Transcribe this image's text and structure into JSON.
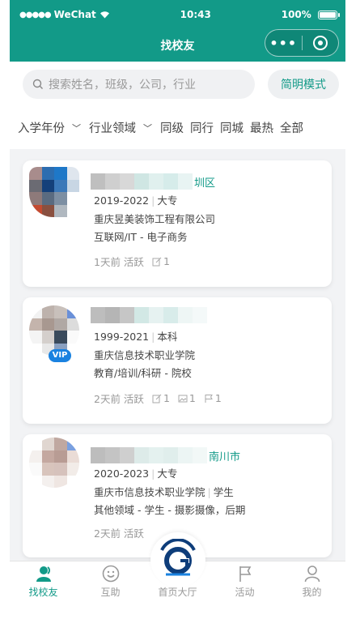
{
  "status": {
    "signal": "●●●●●",
    "carrier": "WeChat",
    "time": "10:43",
    "battery": "100%"
  },
  "nav": {
    "title": "找校友"
  },
  "search": {
    "placeholder": "搜索姓名，班级，公司，行业",
    "simple_mode_label": "简明模式"
  },
  "filters": [
    {
      "label": "入学年份",
      "dropdown": true
    },
    {
      "label": "行业领域",
      "dropdown": true
    },
    {
      "label": "同级",
      "dropdown": false
    },
    {
      "label": "同行",
      "dropdown": false
    },
    {
      "label": "同城",
      "dropdown": false
    },
    {
      "label": "最热",
      "dropdown": false
    },
    {
      "label": "全部",
      "dropdown": false
    }
  ],
  "cards": [
    {
      "location": "圳区",
      "years": "2019-2022",
      "degree": "大专",
      "org": "重庆昱美装饰工程有限公司",
      "industry": "互联网/IT - 电子商务",
      "active": "1天前 活跃",
      "counts": {
        "posts": "1"
      },
      "vip": false
    },
    {
      "location": "",
      "years": "1999-2021",
      "degree": "本科",
      "org": "重庆信息技术职业学院",
      "industry": "教育/培训/科研 - 院校",
      "active": "2天前 活跃",
      "counts": {
        "posts": "1",
        "photos": "1",
        "flags": "1"
      },
      "vip": true,
      "vip_label": "VIP"
    },
    {
      "location": "南川市",
      "years": "2020-2023",
      "degree": "大专",
      "org": "重庆市信息技术职业学院",
      "org_role": "学生",
      "industry": "其他领域 - 学生 - 摄影摄像，后期",
      "active": "2天前 活跃",
      "counts": {},
      "vip": false
    }
  ],
  "tabbar": [
    {
      "label": "找校友",
      "icon": "user-group-icon",
      "active": true
    },
    {
      "label": "互助",
      "icon": "smile-icon",
      "active": false
    },
    {
      "label": "首页大厅",
      "icon": "school-logo-icon",
      "active": false
    },
    {
      "label": "活动",
      "icon": "flag-icon",
      "active": false
    },
    {
      "label": "我的",
      "icon": "person-icon",
      "active": false
    }
  ],
  "colors": {
    "brand": "#129a88",
    "vip": "#1a82e0"
  }
}
